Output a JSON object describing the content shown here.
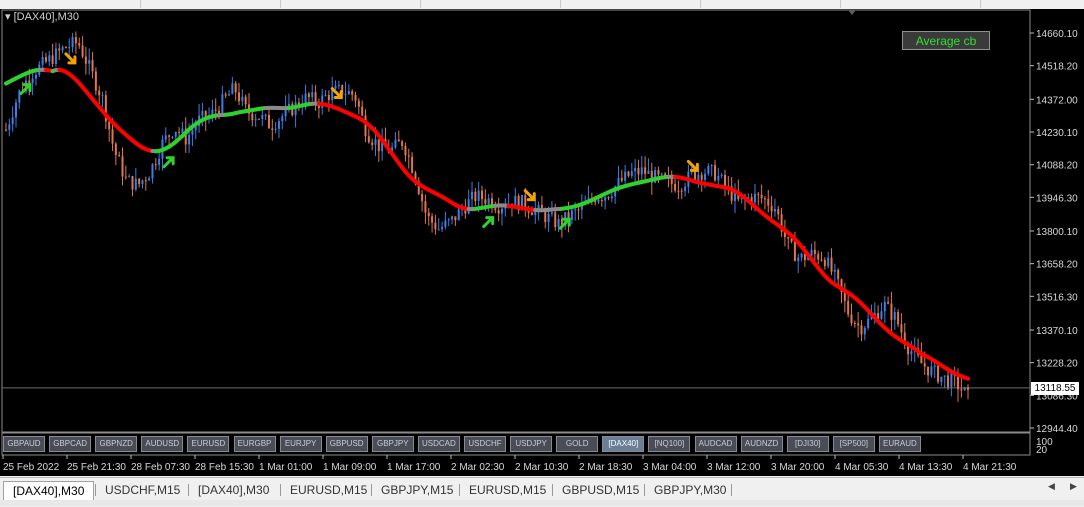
{
  "chart": {
    "title": "[DAX40],M30",
    "indicator_button": "Average cb",
    "current_price": "13118.55",
    "colors": {
      "background": "#000000",
      "candle_up": "#3d7ee6",
      "candle_down": "#e0774a",
      "ma_up": "#2fd12f",
      "ma_down": "#ff0000",
      "ma_flat": "#8a8a8a",
      "arrow_up": "#2fd12f",
      "arrow_down": "#f2a500"
    },
    "price_axis": [
      "14660.10",
      "14518.20",
      "14372.00",
      "14230.10",
      "14088.20",
      "13946.30",
      "13800.10",
      "13658.20",
      "13516.30",
      "13370.10",
      "13228.20",
      "13086.30",
      "12944.40"
    ],
    "subwindow_axis": [
      "100",
      "20"
    ],
    "time_axis": [
      "25 Feb 2022",
      "25 Feb 21:30",
      "28 Feb 07:30",
      "28 Feb 15:30",
      "1 Mar 01:00",
      "1 Mar 09:00",
      "1 Mar 17:00",
      "2 Mar 02:30",
      "2 Mar 10:30",
      "2 Mar 18:30",
      "3 Mar 04:00",
      "3 Mar 12:00",
      "3 Mar 20:00",
      "4 Mar 05:30",
      "4 Mar 13:30",
      "4 Mar 21:30"
    ],
    "symbol_buttons": [
      "GBPAUD",
      "GBPCAD",
      "GBPNZD",
      "AUDUSD",
      "EURUSD",
      "EURGBP",
      "EURJPY",
      "GBPUSD",
      "GBPJPY",
      "USDCAD",
      "USDCHF",
      "USDJPY",
      "GOLD",
      "[DAX40]",
      "[NQ100]",
      "AUDCAD",
      "AUDNZD",
      "[DJI30]",
      "[SP500]",
      "EURAUD"
    ],
    "active_symbol": "[DAX40]",
    "price_series": {
      "x_labels_note": "values approximate from axis",
      "closes": [
        14240,
        14390,
        14480,
        14520,
        14560,
        14600,
        14620,
        14500,
        14380,
        14150,
        14020,
        14000,
        14060,
        14180,
        14250,
        14200,
        14280,
        14300,
        14360,
        14420,
        14320,
        14300,
        14260,
        14300,
        14340,
        14380,
        14360,
        14400,
        14410,
        14390,
        14230,
        14170,
        14150,
        14190,
        14050,
        13860,
        13810,
        13840,
        13900,
        13950,
        13940,
        13910,
        13930,
        13920,
        13890,
        13860,
        13830,
        13870,
        13900,
        13950,
        13960,
        14010,
        14050,
        14060,
        14030,
        14010,
        14000,
        14040,
        14060,
        14050,
        13980,
        13920,
        13950,
        13940,
        13900,
        13740,
        13680,
        13700,
        13690,
        13590,
        13450,
        13380,
        13420,
        13480,
        13420,
        13300,
        13230,
        13190,
        13160,
        13140,
        13080
      ]
    }
  },
  "tabs": [
    "[DAX40],M30",
    "USDCHF,M15",
    "[DAX40],M30",
    "EURUSD,M15",
    "GBPJPY,M15",
    "EURUSD,M15",
    "GBPUSD,M15",
    "GBPJPY,M30"
  ],
  "active_tab_index": 0
}
